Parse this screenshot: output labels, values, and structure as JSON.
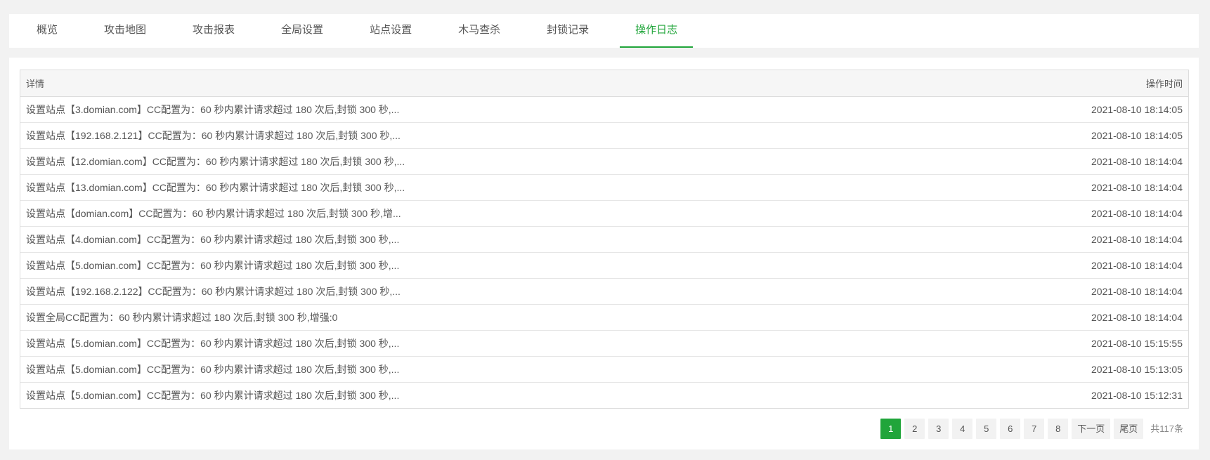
{
  "tabs": [
    {
      "label": "概览",
      "active": false
    },
    {
      "label": "攻击地图",
      "active": false
    },
    {
      "label": "攻击报表",
      "active": false
    },
    {
      "label": "全局设置",
      "active": false
    },
    {
      "label": "站点设置",
      "active": false
    },
    {
      "label": "木马查杀",
      "active": false
    },
    {
      "label": "封锁记录",
      "active": false
    },
    {
      "label": "操作日志",
      "active": true
    }
  ],
  "table": {
    "headers": {
      "detail": "详情",
      "time": "操作时间"
    },
    "rows": [
      {
        "detail": "设置站点【3.domian.com】CC配置为：60 秒内累计请求超过 180 次后,封锁 300 秒,...",
        "time": "2021-08-10 18:14:05"
      },
      {
        "detail": "设置站点【192.168.2.121】CC配置为：60 秒内累计请求超过 180 次后,封锁 300 秒,...",
        "time": "2021-08-10 18:14:05"
      },
      {
        "detail": "设置站点【12.domian.com】CC配置为：60 秒内累计请求超过 180 次后,封锁 300 秒,...",
        "time": "2021-08-10 18:14:04"
      },
      {
        "detail": "设置站点【13.domian.com】CC配置为：60 秒内累计请求超过 180 次后,封锁 300 秒,...",
        "time": "2021-08-10 18:14:04"
      },
      {
        "detail": "设置站点【domian.com】CC配置为：60 秒内累计请求超过 180 次后,封锁 300 秒,增...",
        "time": "2021-08-10 18:14:04"
      },
      {
        "detail": "设置站点【4.domian.com】CC配置为：60 秒内累计请求超过 180 次后,封锁 300 秒,...",
        "time": "2021-08-10 18:14:04"
      },
      {
        "detail": "设置站点【5.domian.com】CC配置为：60 秒内累计请求超过 180 次后,封锁 300 秒,...",
        "time": "2021-08-10 18:14:04"
      },
      {
        "detail": "设置站点【192.168.2.122】CC配置为：60 秒内累计请求超过 180 次后,封锁 300 秒,...",
        "time": "2021-08-10 18:14:04"
      },
      {
        "detail": "设置全局CC配置为：60 秒内累计请求超过 180 次后,封锁 300 秒,增强:0",
        "time": "2021-08-10 18:14:04"
      },
      {
        "detail": "设置站点【5.domian.com】CC配置为：60 秒内累计请求超过 180 次后,封锁 300 秒,...",
        "time": "2021-08-10 15:15:55"
      },
      {
        "detail": "设置站点【5.domian.com】CC配置为：60 秒内累计请求超过 180 次后,封锁 300 秒,...",
        "time": "2021-08-10 15:13:05"
      },
      {
        "detail": "设置站点【5.domian.com】CC配置为：60 秒内累计请求超过 180 次后,封锁 300 秒,...",
        "time": "2021-08-10 15:12:31"
      }
    ]
  },
  "pagination": {
    "pages": [
      "1",
      "2",
      "3",
      "4",
      "5",
      "6",
      "7",
      "8"
    ],
    "current": "1",
    "next_label": "下一页",
    "last_label": "尾页",
    "total_text": "共117条"
  },
  "colors": {
    "accent": "#20a53a",
    "background": "#f2f2f2"
  }
}
